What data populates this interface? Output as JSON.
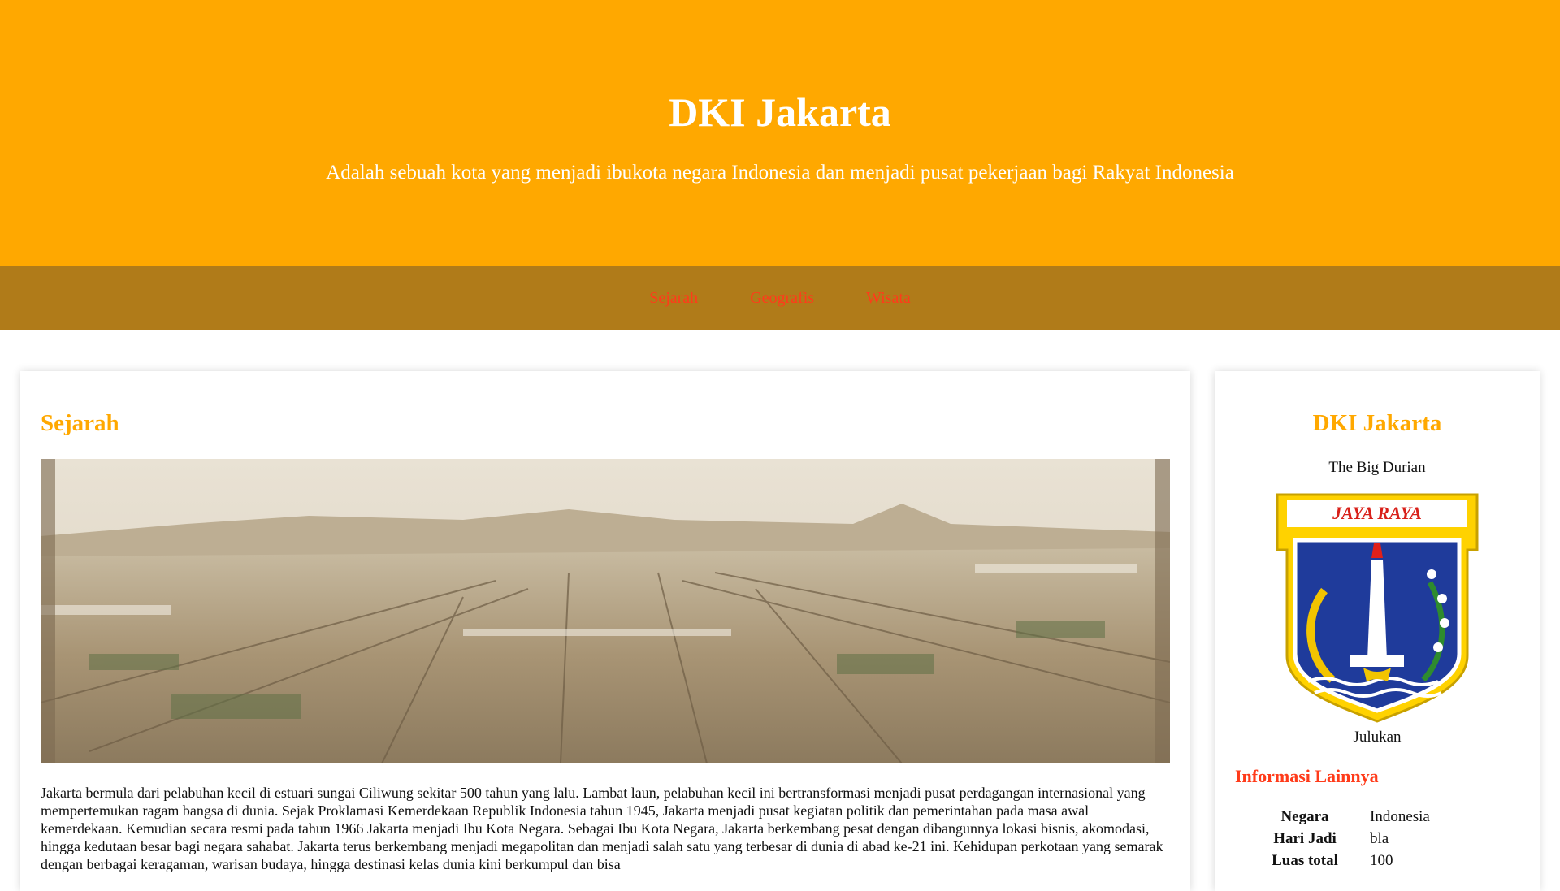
{
  "header": {
    "title": "DKI Jakarta",
    "subtitle": "Adalah sebuah kota yang menjadi ibukota negara Indonesia dan menjadi pusat pekerjaan bagi Rakyat Indonesia"
  },
  "nav": {
    "items": [
      {
        "label": "Sejarah"
      },
      {
        "label": "Geografis"
      },
      {
        "label": "Wisata"
      }
    ]
  },
  "main": {
    "section_title": "Sejarah",
    "image_icon": "old-batavia-painting",
    "paragraph": "Jakarta bermula dari pelabuhan kecil di estuari sungai Ciliwung sekitar 500 tahun yang lalu. Lambat laun, pelabuhan kecil ini bertransformasi menjadi pusat perdagangan internasional yang mempertemukan ragam bangsa di dunia. Sejak Proklamasi Kemerdekaan Republik Indonesia tahun 1945, Jakarta menjadi pusat kegiatan politik dan pemerintahan pada masa awal kemerdekaan. Kemudian secara resmi pada tahun 1966 Jakarta menjadi Ibu Kota Negara. Sebagai Ibu Kota Negara, Jakarta berkembang pesat dengan dibangunnya lokasi bisnis, akomodasi, hingga kedutaan besar bagi negara sahabat. Jakarta terus berkembang menjadi megapolitan dan menjadi salah satu yang terbesar di dunia di abad ke-21 ini. Kehidupan perkotaan yang semarak dengan berbagai keragaman, warisan budaya, hingga destinasi kelas dunia kini berkumpul dan bisa"
  },
  "sidebar": {
    "title": "DKI Jakarta",
    "nickname": "The Big Durian",
    "emblem_text": "JAYA RAYA",
    "caption": "Julukan",
    "info_title": "Informasi Lainnya",
    "rows": [
      {
        "key": "Negara",
        "value": "Indonesia"
      },
      {
        "key": "Hari Jadi",
        "value": "bla"
      },
      {
        "key": "Luas total",
        "value": "100"
      }
    ]
  },
  "colors": {
    "hero_bg": "#ffa800",
    "nav_bg": "#b07b19",
    "nav_link": "#ff3b1a",
    "heading": "#ffa800",
    "info_heading": "#ff3b1a"
  }
}
